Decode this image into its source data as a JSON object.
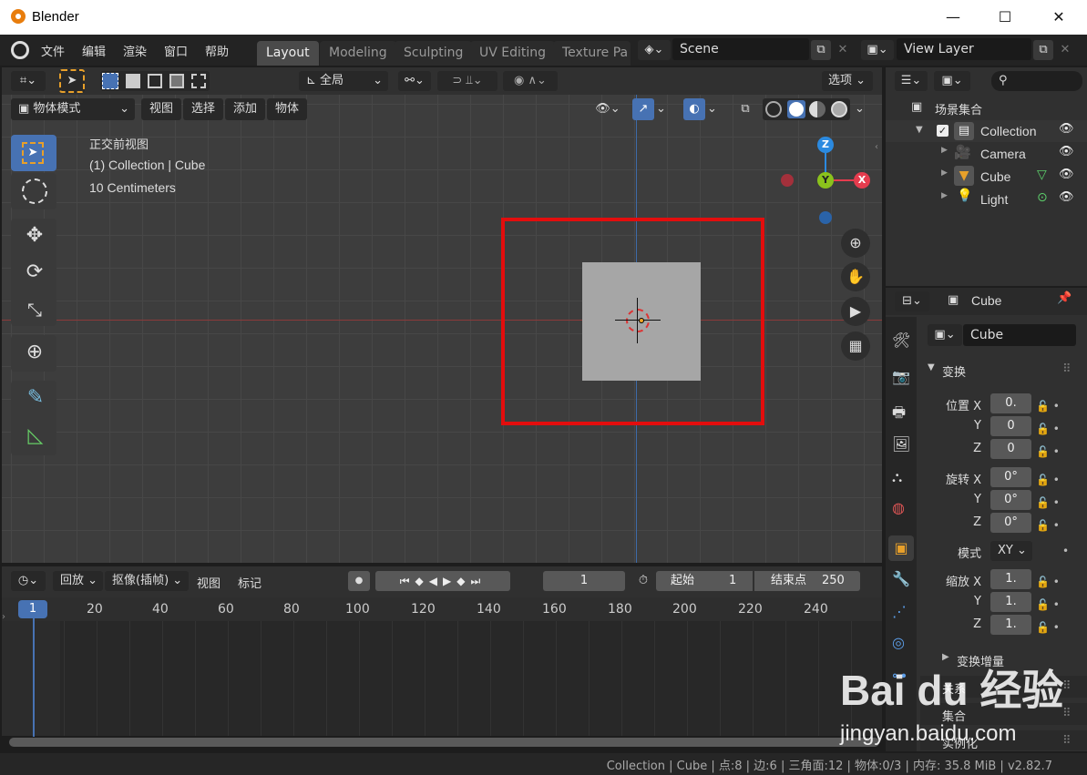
{
  "window": {
    "title": "Blender",
    "controls": [
      "—",
      "☐",
      "✕"
    ]
  },
  "menu": [
    "文件",
    "编辑",
    "渲染",
    "窗口",
    "帮助"
  ],
  "workspaces": [
    "Layout",
    "Modeling",
    "Sculpting",
    "UV Editing",
    "Texture Pa"
  ],
  "scene": {
    "name": "Scene",
    "view_layer": "View Layer"
  },
  "viewport": {
    "transform_orientation": "全局",
    "options": "选项",
    "mode": "物体模式",
    "menus": [
      "视图",
      "选择",
      "添加",
      "物体"
    ],
    "overlay_lines": [
      "正交前视图",
      "(1) Collection | Cube",
      "10 Centimeters"
    ],
    "gizmo": {
      "z": "Z",
      "y": "Y",
      "x": "X"
    },
    "highlight_color": "#e30d0d"
  },
  "outliner": {
    "scene_collection": "场景集合",
    "collection": "Collection",
    "items": [
      "Camera",
      "Cube",
      "Light"
    ]
  },
  "properties": {
    "header_object": "Cube",
    "object_name": "Cube",
    "transform_section": "变换",
    "location_label": "位置 X",
    "rotation_label": "旋转 X",
    "mode_label": "模式",
    "mode_value": "XY",
    "scale_label": "缩放 X",
    "axis_y": "Y",
    "axis_z": "Z",
    "location": [
      "0.",
      "0",
      "0"
    ],
    "rotation": [
      "0°",
      "0°",
      "0°"
    ],
    "scale": [
      "1.",
      "1.",
      "1."
    ],
    "delta_transform": "变换增量",
    "relations": "关系",
    "collections": "集合",
    "instancing": "实例化"
  },
  "timeline": {
    "menus": [
      "回放",
      "抠像(插帧)",
      "视图",
      "标记"
    ],
    "current_frame": "1",
    "start_label": "起始",
    "start": "1",
    "end_label": "结束点",
    "end": "250",
    "ticks": [
      "1",
      "20",
      "40",
      "60",
      "80",
      "100",
      "120",
      "140",
      "160",
      "180",
      "200",
      "220",
      "240"
    ]
  },
  "status_bar": "Collection | Cube | 点:8 | 边:6 | 三角面:12 | 物体:0/3  | 内存: 35.8 MiB | v2.82.7",
  "watermark": {
    "brand": "Bai du 经验",
    "url": "jingyan.baidu.com"
  }
}
